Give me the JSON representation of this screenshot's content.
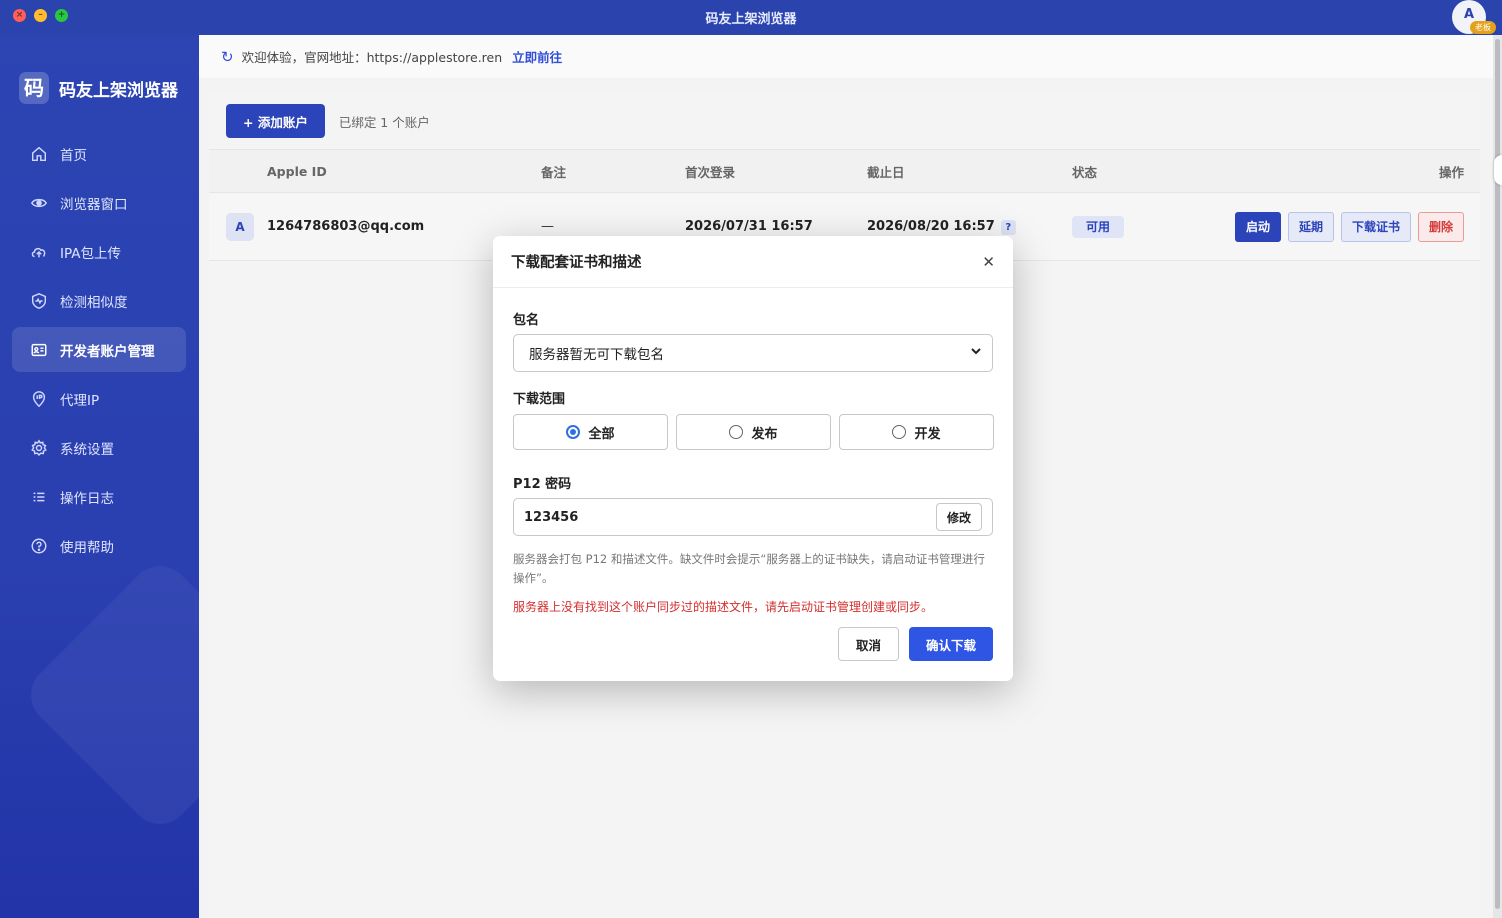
{
  "window": {
    "title": "码友上架浏览器",
    "avatar_letter": "A",
    "avatar_badge": "老板"
  },
  "brand": {
    "logo_char": "码",
    "name": "码友上架浏览器"
  },
  "sidebar": {
    "items": [
      {
        "label": "首页",
        "icon": "home-icon"
      },
      {
        "label": "浏览器窗口",
        "icon": "eye-icon"
      },
      {
        "label": "IPA包上传",
        "icon": "cloud-upload-icon"
      },
      {
        "label": "检测相似度",
        "icon": "shield-pulse-icon"
      },
      {
        "label": "开发者账户管理",
        "icon": "id-card-icon",
        "active": true
      },
      {
        "label": "代理IP",
        "icon": "location-ip-icon"
      },
      {
        "label": "系统设置",
        "icon": "gear-icon"
      },
      {
        "label": "操作日志",
        "icon": "list-icon"
      },
      {
        "label": "使用帮助",
        "icon": "question-icon"
      }
    ]
  },
  "notice": {
    "text": "欢迎体验，官网地址：https://applestore.ren",
    "link": "立即前往"
  },
  "toolbar": {
    "add_label": "+ 添加账户",
    "bound_text": "已绑定 1 个账户"
  },
  "table": {
    "headers": {
      "apple_id": "Apple ID",
      "note": "备注",
      "first_login": "首次登录",
      "end_date": "截止日",
      "status": "状态",
      "ops": "操作"
    },
    "rows": [
      {
        "avatar": "A",
        "apple_id": "1264786803@qq.com",
        "note": "—",
        "first_login": "2026/07/31 16:57",
        "end_date": "2026/08/20 16:57",
        "help": "?",
        "status": "可用",
        "ops": {
          "start": "启动",
          "extend": "延期",
          "download_cert": "下载证书",
          "delete": "删除"
        }
      }
    ]
  },
  "modal": {
    "title": "下载配套证书和描述",
    "package_label": "包名",
    "package_value": "服务器暂无可下载包名",
    "scope_label": "下载范围",
    "scope_options": [
      {
        "label": "全部",
        "checked": true
      },
      {
        "label": "发布",
        "checked": false
      },
      {
        "label": "开发",
        "checked": false
      }
    ],
    "p12_label": "P12 密码",
    "p12_value": "123456",
    "edit_label": "修改",
    "hint": "服务器会打包 P12 和描述文件。缺文件时会提示“服务器上的证书缺失，请启动证书管理进行操作”。",
    "error": "服务器上没有找到这个账户同步过的描述文件，请先启动证书管理创建或同步。",
    "cancel_label": "取消",
    "confirm_label": "确认下载"
  },
  "colors": {
    "primary": "#2c44ba",
    "confirm": "#2f55e4",
    "error": "#d32f2f",
    "sidebar": "#2a3fb0"
  }
}
